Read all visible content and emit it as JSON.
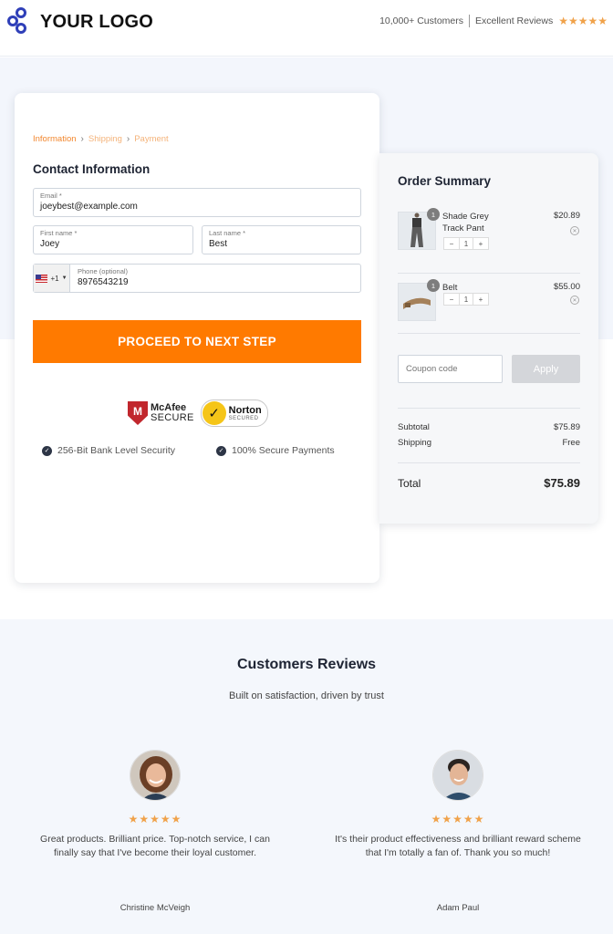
{
  "header": {
    "logo_text": "YOUR LOGO",
    "customers": "10,000+ Customers",
    "reviews": "Excellent Reviews",
    "rating_stars": "★★★★★",
    "rating_value": 5
  },
  "checkout": {
    "breadcrumb": [
      "Information",
      "Shipping",
      "Payment"
    ],
    "section_title": "Contact Information",
    "fields": {
      "email": {
        "label": "Email *",
        "value": "joeybest@example.com"
      },
      "first_name": {
        "label": "First name *",
        "value": "Joey"
      },
      "last_name": {
        "label": "Last name *",
        "value": "Best"
      },
      "phone": {
        "label": "Phone (optional)",
        "value": "8976543219",
        "country_code": "+1"
      }
    },
    "cta_label": "PROCEED TO NEXT STEP",
    "badges": {
      "mcafee": {
        "line1": "McAfee",
        "line2": "SECURE"
      },
      "norton": {
        "line1": "Norton",
        "line2": "SECURED"
      }
    },
    "security_points": [
      "256-Bit Bank Level Security",
      "100% Secure Payments"
    ]
  },
  "order_summary": {
    "title": "Order Summary",
    "items": [
      {
        "name": "Shade Grey Track Pant",
        "price": "$20.89",
        "quantity": "1",
        "thumb_icon": "track-pant-image"
      },
      {
        "name": "Belt",
        "price": "$55.00",
        "quantity": "1",
        "thumb_icon": "belt-image"
      }
    ],
    "coupon_placeholder": "Coupon code",
    "apply_label": "Apply",
    "subtotal_label": "Subtotal",
    "subtotal_value": "$75.89",
    "shipping_label": "Shipping",
    "shipping_value": "Free",
    "total_label": "Total",
    "total_value": "$75.89"
  },
  "reviews": {
    "title": "Customers Reviews",
    "subtitle": "Built on satisfaction, driven by trust",
    "items": [
      {
        "stars": "★★★★★",
        "rating": 5,
        "text": "Great products. Brilliant price. Top-notch service, I can finally say that I've become their loyal customer.",
        "author": "Christine McVeigh"
      },
      {
        "stars": "★★★★★",
        "rating": 5,
        "text": "It's their product effectiveness and brilliant reward scheme that I'm totally a fan of. Thank you so much!",
        "author": "Adam Paul"
      }
    ]
  },
  "colors": {
    "accent_orange": "#ff7a00",
    "logo_blue": "#2f3fb8",
    "star_gold": "#f0a24a",
    "band_bg": "#f3f6fc"
  }
}
